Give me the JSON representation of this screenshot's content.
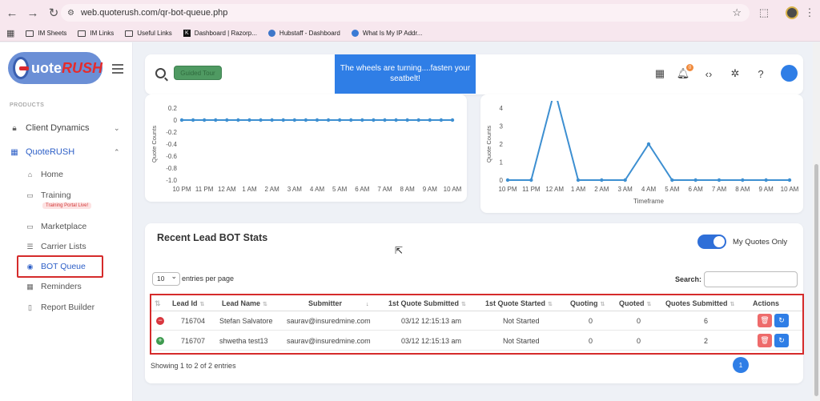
{
  "browser": {
    "url": "web.quoterush.com/qr-bot-queue.php",
    "bookmarks": [
      "IM Sheets",
      "IM Links",
      "Useful Links",
      "Dashboard | Razorp...",
      "Hubstaff - Dashboard",
      "What Is My IP Addr..."
    ]
  },
  "sidebar": {
    "logo_text_a": "uote",
    "logo_text_b": "RUSH",
    "section_label": "PRODUCTS",
    "items": {
      "client_dynamics": "Client Dynamics",
      "quoterush": "QuoteRUSH"
    },
    "sub_items": {
      "home": "Home",
      "training": "Training",
      "training_badge": "Training Portal Live!",
      "marketplace": "Marketplace",
      "carrier_lists": "Carrier Lists",
      "bot_queue": "BOT Queue",
      "reminders": "Reminders",
      "report_builder": "Report Builder"
    }
  },
  "header": {
    "guided_tour": "Guided Tour",
    "toast": "The wheels are turning....fasten your seatbelt!",
    "notification_count": "0"
  },
  "chart_data": [
    {
      "type": "line",
      "title": "",
      "ylabel": "Quote Counts",
      "xlabel": "",
      "categories": [
        "10 PM",
        "11 PM",
        "12 AM",
        "1 AM",
        "2 AM",
        "3 AM",
        "4 AM",
        "5 AM",
        "6 AM",
        "7 AM",
        "8 AM",
        "9 AM",
        "10 AM"
      ],
      "x_points": [
        0,
        0.5,
        1,
        1.5,
        2,
        2.5,
        3,
        3.5,
        4,
        4.5,
        5,
        5.5,
        6,
        6.5,
        7,
        7.5,
        8,
        8.5,
        9,
        9.5,
        10,
        10.5,
        11,
        11.5,
        12
      ],
      "series": [
        {
          "name": "",
          "values": [
            0,
            0,
            0,
            0,
            0,
            0,
            0,
            0,
            0,
            0,
            0,
            0,
            0,
            0,
            0,
            0,
            0,
            0,
            0,
            0,
            0,
            0,
            0,
            0,
            0
          ]
        }
      ],
      "yticks": [
        "0.2",
        "0",
        "-0.2",
        "-0.4",
        "-0.6",
        "-0.8",
        "-1.0"
      ],
      "ylim": [
        -1.0,
        0.2
      ]
    },
    {
      "type": "line",
      "title": "",
      "ylabel": "Quote Counts",
      "xlabel": "Timeframe",
      "categories": [
        "10 PM",
        "11 PM",
        "12 AM",
        "1 AM",
        "2 AM",
        "3 AM",
        "4 AM",
        "5 AM",
        "6 AM",
        "7 AM",
        "8 AM",
        "9 AM",
        "10 AM"
      ],
      "series": [
        {
          "name": "",
          "values": [
            0,
            0,
            5,
            0,
            0,
            0,
            2,
            0,
            0,
            0,
            0,
            0,
            0
          ]
        }
      ],
      "yticks": [
        "4",
        "3",
        "2",
        "1",
        "0"
      ],
      "ylim": [
        0,
        4
      ]
    }
  ],
  "table": {
    "title": "Recent Lead BOT Stats",
    "toggle_label": "My Quotes Only",
    "entries_value": "10",
    "entries_label": "entries per page",
    "search_label": "Search:",
    "columns": [
      "Lead Id",
      "Lead Name",
      "Submitter",
      "1st Quote Submitted",
      "1st Quote Started",
      "Quoting",
      "Quoted",
      "Quotes Submitted",
      "Actions"
    ],
    "rows": [
      {
        "lead_id": "716704",
        "lead_name": "Stefan Salvatore",
        "submitter": "saurav@insuredmine.com",
        "first_submitted": "03/12 12:15:13 am",
        "first_started": "Not Started",
        "quoting": "0",
        "quoted": "0",
        "quotes_submitted": "6"
      },
      {
        "lead_id": "716707",
        "lead_name": "shwetha test13",
        "submitter": "saurav@insuredmine.com",
        "first_submitted": "03/12 12:15:13 am",
        "first_started": "Not Started",
        "quoting": "0",
        "quoted": "0",
        "quotes_submitted": "2"
      }
    ],
    "footer": "Showing 1 to 2 of 2 entries",
    "page": "1"
  },
  "colors": {
    "accent": "#2f7ee6",
    "line": "#3d8fd1",
    "highlight": "#d52b2b"
  }
}
